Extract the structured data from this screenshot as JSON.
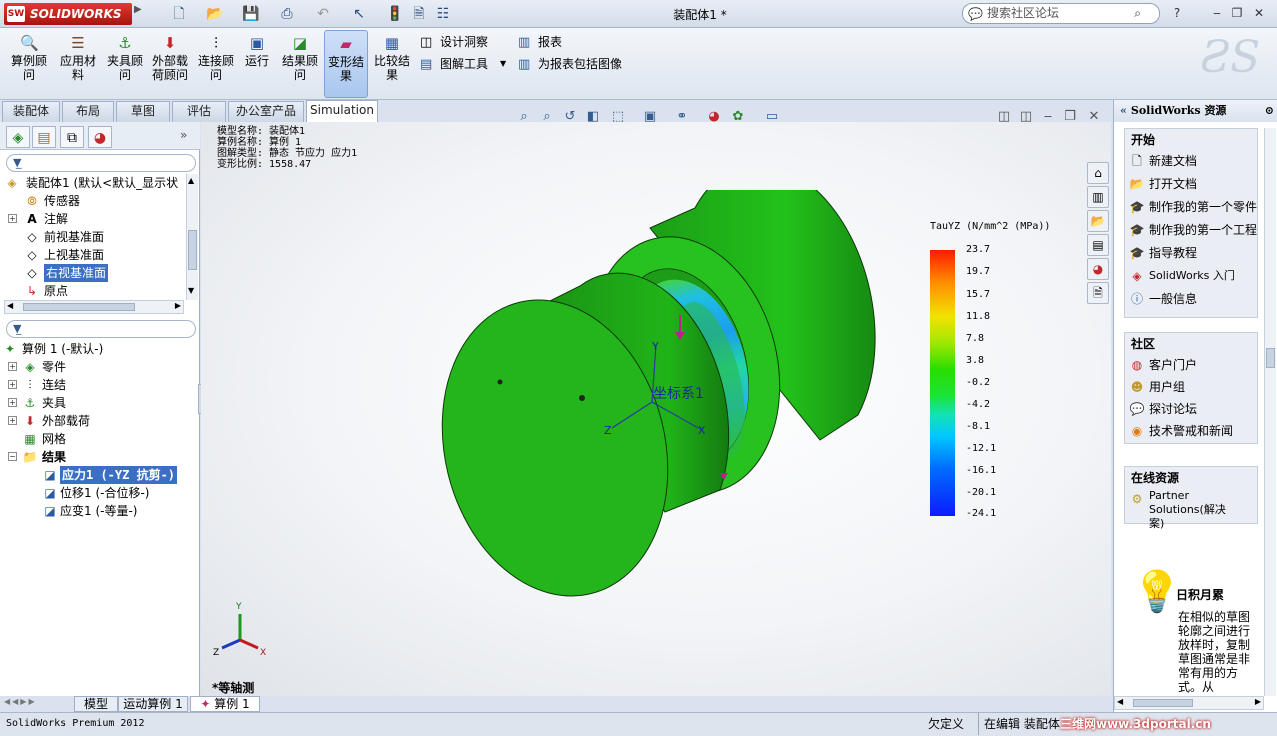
{
  "titlebar": {
    "brand": "SOLIDWORKS",
    "brand_badge": "SW",
    "doc_title": "装配体1 *",
    "search_placeholder": "搜索社区论坛",
    "help_label": "?"
  },
  "ribbon": {
    "buttons": [
      {
        "label": "算例顾\n问",
        "icon": "study-advisor-icon"
      },
      {
        "label": "应用材\n料",
        "icon": "apply-material-icon"
      },
      {
        "label": "夹具顾\n问",
        "icon": "fixtures-advisor-icon"
      },
      {
        "label": "外部载\n荷顾问",
        "icon": "external-loads-advisor-icon"
      },
      {
        "label": "连接顾\n问",
        "icon": "connections-advisor-icon"
      },
      {
        "label": "运行",
        "icon": "run-icon"
      },
      {
        "label": "结果顾\n问",
        "icon": "results-advisor-icon"
      },
      {
        "label": "变形结\n果",
        "icon": "deformed-result-icon"
      },
      {
        "label": "比较结\n果",
        "icon": "compare-results-icon"
      }
    ],
    "small": {
      "design_insight": "设计洞察",
      "plot_tools": "图解工具",
      "report": "报表",
      "include_image": "为报表包括图像"
    }
  },
  "tabs": [
    "装配体",
    "布局",
    "草图",
    "评估",
    "办公室产品",
    "Simulation"
  ],
  "tree1": {
    "root": "装配体1 (默认<默认_显示状",
    "items": [
      "传感器",
      "注解",
      "前视基准面",
      "上视基准面",
      "右视基准面",
      "原点"
    ]
  },
  "tree2": {
    "root": "算例 1 (-默认-)",
    "items": [
      "零件",
      "连结",
      "夹具",
      "外部载荷",
      "网格",
      "结果"
    ],
    "results": [
      "应力1 (-YZ 抗剪-)",
      "位移1 (-合位移-)",
      "应变1 (-等量-)"
    ]
  },
  "info": {
    "l1": "模型名称: 装配体1",
    "l2": "算例名称: 算例 1",
    "l3": "图解类型: 静态 节应力 应力1",
    "l4": "变形比例: 1558.47"
  },
  "legend": {
    "title": "TauYZ (N/mm^2 (MPa))",
    "ticks": [
      "23.7",
      "19.7",
      "15.7",
      "11.8",
      "7.8",
      "3.8",
      "-0.2",
      "-4.2",
      "-8.1",
      "-12.1",
      "-16.1",
      "-20.1",
      "-24.1"
    ]
  },
  "model": {
    "coord_label": "坐标系1",
    "axis_x": "X",
    "axis_y": "Y",
    "axis_z": "Z"
  },
  "triad": {
    "x": "X",
    "y": "Y",
    "z": "Z"
  },
  "view_label": "*等轴测",
  "rightpanel": {
    "title": "SolidWorks 资源",
    "start": {
      "header": "开始",
      "items": [
        "新建文档",
        "打开文档",
        "制作我的第一个零件",
        "制作我的第一个工程",
        "指导教程",
        "SolidWorks 入门",
        "一般信息"
      ]
    },
    "community": {
      "header": "社区",
      "items": [
        "客户门户",
        "用户组",
        "探讨论坛",
        "技术警戒和新闻"
      ]
    },
    "online": {
      "header": "在线资源",
      "items": [
        "Partner Solutions(解决\n案)"
      ]
    },
    "tip": {
      "header": "日积月累",
      "body": "在相似的草图\n轮廓之间进行\n放样时，复制\n草图通常是非\n常有用的方\n式。从"
    }
  },
  "bottomtabs": [
    "模型",
    "运动算例 1",
    "算例 1"
  ],
  "status": {
    "product": "SolidWorks Premium 2012",
    "undefined": "欠定义",
    "editing": "在编辑 装配体",
    "watermark": "三维网www.3dportal.cn"
  },
  "colors": {
    "accent": "#3a6fc4",
    "part_green": "#22b21c",
    "brand_red": "#c4211a"
  }
}
